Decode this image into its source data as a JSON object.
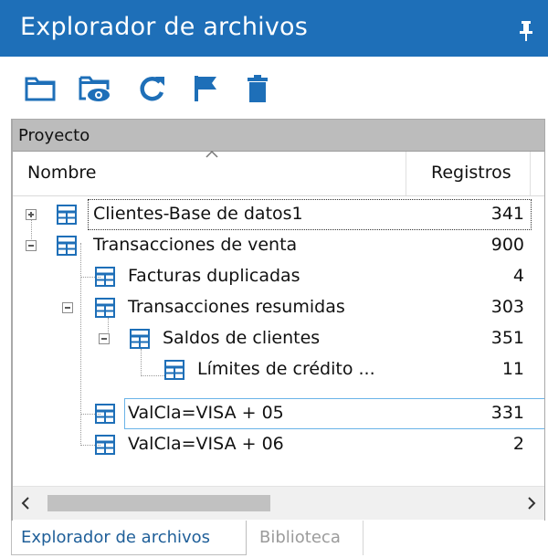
{
  "panel": {
    "title": "Explorador de archivos",
    "pin_icon": "pin-icon"
  },
  "toolbar": {
    "buttons": [
      {
        "name": "folder-button",
        "icon": "folder-icon"
      },
      {
        "name": "view-button",
        "icon": "eye-folder-icon"
      },
      {
        "name": "refresh-button",
        "icon": "refresh-icon"
      },
      {
        "name": "flag-button",
        "icon": "flag-icon"
      },
      {
        "name": "delete-button",
        "icon": "trash-icon"
      }
    ],
    "icon_color": "#1e6fb8"
  },
  "tree": {
    "section_label": "Proyecto",
    "columns": {
      "name": "Nombre",
      "records": "Registros"
    },
    "rows": [
      {
        "label": "Clientes-Base de datos1",
        "count": "341"
      },
      {
        "label": "Transacciones de venta",
        "count": "900"
      },
      {
        "label": "Facturas duplicadas",
        "count": "4"
      },
      {
        "label": "Transacciones resumidas",
        "count": "303"
      },
      {
        "label": "Saldos de clientes",
        "count": "351"
      },
      {
        "label": "Límites de crédito ...",
        "count": "11"
      },
      {
        "label": "ValCla=VISA + 05",
        "count": "331"
      },
      {
        "label": "ValCla=VISA + 06",
        "count": "2"
      }
    ]
  },
  "tabs": [
    {
      "label": "Explorador de archivos",
      "active": true
    },
    {
      "label": "Biblioteca",
      "active": false
    }
  ],
  "colors": {
    "accent": "#1e6fb8",
    "selection_border": "#6ab3e8",
    "header_gray": "#bcbcbc"
  }
}
